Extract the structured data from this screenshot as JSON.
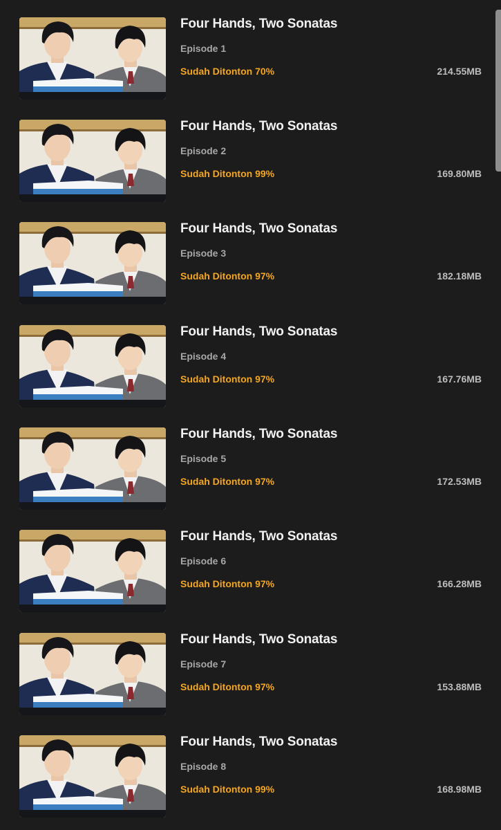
{
  "episodes": [
    {
      "title": "Four Hands, Two Sonatas",
      "episode": "Episode 1",
      "progress": "Sudah Ditonton 70%",
      "size": "214.55MB"
    },
    {
      "title": "Four Hands, Two Sonatas",
      "episode": "Episode 2",
      "progress": "Sudah Ditonton 99%",
      "size": "169.80MB"
    },
    {
      "title": "Four Hands, Two Sonatas",
      "episode": "Episode 3",
      "progress": "Sudah Ditonton 97%",
      "size": "182.18MB"
    },
    {
      "title": "Four Hands, Two Sonatas",
      "episode": "Episode 4",
      "progress": "Sudah Ditonton 97%",
      "size": "167.76MB"
    },
    {
      "title": "Four Hands, Two Sonatas",
      "episode": "Episode 5",
      "progress": "Sudah Ditonton 97%",
      "size": "172.53MB"
    },
    {
      "title": "Four Hands, Two Sonatas",
      "episode": "Episode 6",
      "progress": "Sudah Ditonton 97%",
      "size": "166.28MB"
    },
    {
      "title": "Four Hands, Two Sonatas",
      "episode": "Episode 7",
      "progress": "Sudah Ditonton 97%",
      "size": "153.88MB"
    },
    {
      "title": "Four Hands, Two Sonatas",
      "episode": "Episode 8",
      "progress": "Sudah Ditonton 99%",
      "size": "168.98MB"
    }
  ],
  "colors": {
    "background": "#1c1c1c",
    "title": "#f1f1f1",
    "episode": "#a8a8a8",
    "progress": "#f5a623",
    "size": "#bdbdbd"
  }
}
